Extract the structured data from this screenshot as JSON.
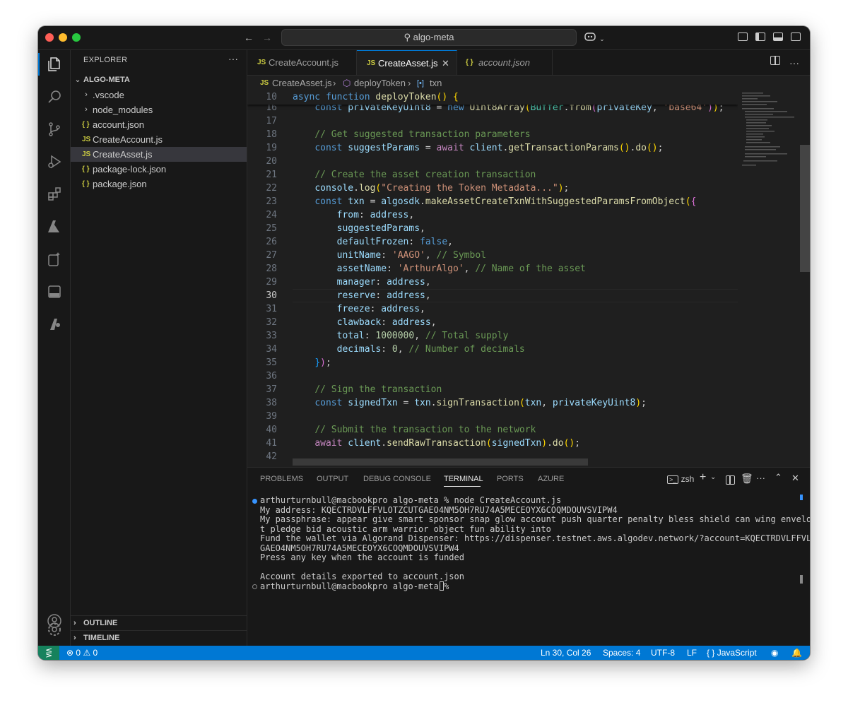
{
  "titlebar": {
    "search_text": "algo-meta"
  },
  "explorer": {
    "title": "EXPLORER",
    "more": "···",
    "root": "ALGO-META",
    "items": [
      {
        "label": ".vscode",
        "type": "folder"
      },
      {
        "label": "node_modules",
        "type": "folder"
      },
      {
        "label": "account.json",
        "type": "json",
        "icon_text": "{ }"
      },
      {
        "label": "CreateAccount.js",
        "type": "js",
        "icon_text": "JS"
      },
      {
        "label": "CreateAsset.js",
        "type": "js",
        "icon_text": "JS",
        "selected": true
      },
      {
        "label": "package-lock.json",
        "type": "json",
        "icon_text": "{ }"
      },
      {
        "label": "package.json",
        "type": "json",
        "icon_text": "{ }"
      }
    ],
    "outline": "OUTLINE",
    "timeline": "TIMELINE"
  },
  "tabs": [
    {
      "label": "CreateAccount.js",
      "icon_text": "JS"
    },
    {
      "label": "CreateAsset.js",
      "icon_text": "JS",
      "active": true
    },
    {
      "label": "account.json",
      "icon_text": "{ }"
    }
  ],
  "breadcrumb": {
    "file": "CreateAsset.js",
    "function": "deployToken",
    "variable": "txn"
  },
  "code": {
    "sticky_line": {
      "num": "10",
      "text": "async function deployToken() {"
    },
    "lines": [
      {
        "num": "16",
        "text": "    const privateKeyUint8 = new Uint8Array(Buffer.from(privateKey, 'base64'));"
      },
      {
        "num": "17",
        "text": ""
      },
      {
        "num": "18",
        "text": "    // Get suggested transaction parameters"
      },
      {
        "num": "19",
        "text": "    const suggestParams = await client.getTransactionParams().do();"
      },
      {
        "num": "20",
        "text": ""
      },
      {
        "num": "21",
        "text": "    // Create the asset creation transaction"
      },
      {
        "num": "22",
        "text": "    console.log(\"Creating the Token Metadata...\");"
      },
      {
        "num": "23",
        "text": "    const txn = algosdk.makeAssetCreateTxnWithSuggestedParamsFromObject({"
      },
      {
        "num": "24",
        "text": "        from: address,"
      },
      {
        "num": "25",
        "text": "        suggestedParams,"
      },
      {
        "num": "26",
        "text": "        defaultFrozen: false,"
      },
      {
        "num": "27",
        "text": "        unitName: 'AAGO', // Symbol"
      },
      {
        "num": "28",
        "text": "        assetName: 'ArthurAlgo', // Name of the asset"
      },
      {
        "num": "29",
        "text": "        manager: address,"
      },
      {
        "num": "30",
        "text": "        reserve: address,"
      },
      {
        "num": "31",
        "text": "        freeze: address,"
      },
      {
        "num": "32",
        "text": "        clawback: address,"
      },
      {
        "num": "33",
        "text": "        total: 1000000, // Total supply"
      },
      {
        "num": "34",
        "text": "        decimals: 0, // Number of decimals"
      },
      {
        "num": "35",
        "text": "    });"
      },
      {
        "num": "36",
        "text": ""
      },
      {
        "num": "37",
        "text": "    // Sign the transaction"
      },
      {
        "num": "38",
        "text": "    const signedTxn = txn.signTransaction(txn, privateKeyUint8);"
      },
      {
        "num": "39",
        "text": ""
      },
      {
        "num": "40",
        "text": "    // Submit the transaction to the network"
      },
      {
        "num": "41",
        "text": "    await client.sendRawTransaction(signedTxn).do();"
      },
      {
        "num": "42",
        "text": ""
      }
    ]
  },
  "panel": {
    "tabs": [
      "PROBLEMS",
      "OUTPUT",
      "DEBUG CONSOLE",
      "TERMINAL",
      "PORTS",
      "AZURE"
    ],
    "active_tab": "TERMINAL",
    "shell": "zsh",
    "terminal_lines": [
      "arthurturnbull@macbookpro algo-meta % node CreateAccount.js",
      "My address: KQECTRDVLFFVLOTZCUTGAEO4NM5OH7RU74A5MECEOYX6COQMDOUVSVIPW4",
      "My passphrase: appear give smart sponsor snap glow account push quarter penalty bless shield can wing envelope lis",
      "t pledge bid acoustic arm warrior object fun ability into",
      "Fund the wallet via Algorand Dispenser: https://dispenser.testnet.aws.algodev.network/?account=KQECTRDVLFFVLOTZCUT",
      "GAEO4NM5OH7RU74A5MECEOYX6COQMDOUVSVIPW4",
      "Press any key when the account is funded",
      "",
      "Account details exported to account.json",
      "arthurturnbull@macbookpro algo-meta % "
    ]
  },
  "statusbar": {
    "errors": "0",
    "warnings": "0",
    "position": "Ln 30, Col 26",
    "spaces": "Spaces: 4",
    "encoding": "UTF-8",
    "eol": "LF",
    "language": "JavaScript"
  },
  "colors": {
    "accent": "#0078d4",
    "js_icon": "#cbcb41",
    "json_icon": "#cbcb41"
  }
}
